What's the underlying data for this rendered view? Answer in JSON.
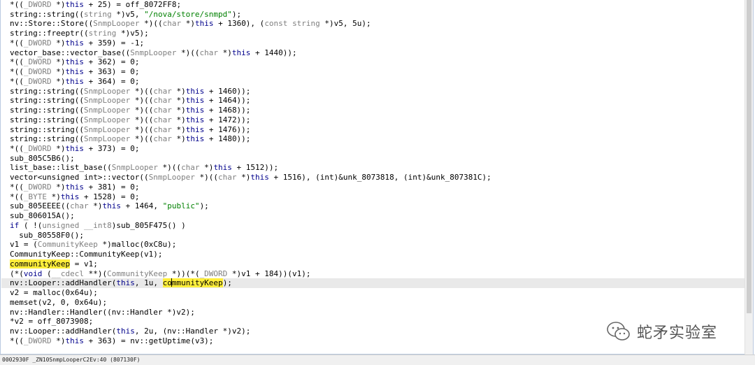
{
  "code_lines": [
    "*((_DWORD *)this + 25) = off_8072FF8;",
    "string::string((string *)v5, \"/nova/store/snmpd\");",
    "nv::Store::Store((SnmpLooper *)((char *)this + 1360), (const string *)v5, 5u);",
    "string::freeptr((string *)v5);",
    "*((_DWORD *)this + 359) = -1;",
    "vector_base::vector_base((SnmpLooper *)((char *)this + 1440));",
    "*((_DWORD *)this + 362) = 0;",
    "*((_DWORD *)this + 363) = 0;",
    "*((_DWORD *)this + 364) = 0;",
    "string::string((SnmpLooper *)((char *)this + 1460));",
    "string::string((SnmpLooper *)((char *)this + 1464));",
    "string::string((SnmpLooper *)((char *)this + 1468));",
    "string::string((SnmpLooper *)((char *)this + 1472));",
    "string::string((SnmpLooper *)((char *)this + 1476));",
    "string::string((SnmpLooper *)((char *)this + 1480));",
    "*((_DWORD *)this + 373) = 0;",
    "sub_805C5B6();",
    "list_base::list_base((SnmpLooper *)((char *)this + 1512));",
    "vector<unsigned int>::vector((SnmpLooper *)((char *)this + 1516), (int)&unk_8073818, (int)&unk_807381C);",
    "*((_DWORD *)this + 381) = 0;",
    "*((_BYTE *)this + 1528) = 0;",
    "sub_805EEEE((char *)this + 1464, \"public\");",
    "sub_806015A();",
    "if ( !(unsigned __int8)sub_805F475() )",
    "  sub_80558F0();",
    "v1 = (CommunityKeep *)malloc(0xC8u);",
    "CommunityKeep::CommunityKeep(v1);",
    "communityKeep = v1;",
    "(*(void (__cdecl **)(CommunityKeep *))(*(_DWORD *)v1 + 184))(v1);",
    "nv::Looper::addHandler(this, 1u, communityKeep);",
    "v2 = malloc(0x64u);",
    "memset(v2, 0, 0x64u);",
    "nv::Handler::Handler((nv::Handler *)v2);",
    "*v2 = off_8073908;",
    "nv::Looper::addHandler(this, 2u, (nv::Handler *)v2);",
    "*((_DWORD *)this + 363) = nv::getUptime(v3);"
  ],
  "highlighted_line": 29,
  "highlighted_identifier": "communityKeep",
  "status_text": "0002930F _ZN10SnmpLooperC2Ev:40 (807130F)",
  "watermark_text": "蛇矛实验室",
  "colors": {
    "keyword": "#00008b",
    "comment_type": "#808080",
    "string": "#008000",
    "highlight": "#ffef3c",
    "current_line": "#e9e9e9"
  },
  "icons": [
    "wechat-icon"
  ]
}
